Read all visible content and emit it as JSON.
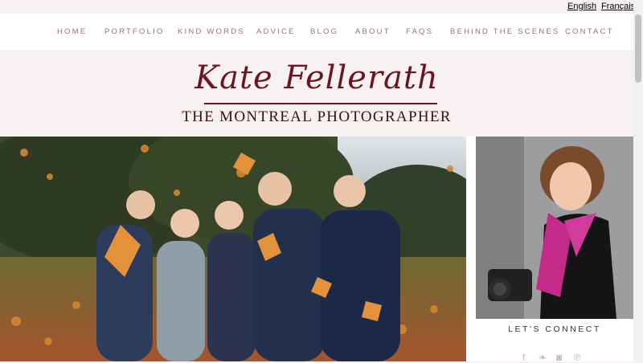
{
  "languages": {
    "english": "English",
    "french": "Français"
  },
  "nav": {
    "items": [
      "HOME",
      "PORTFOLIO",
      "KIND WORDS",
      "ADVICE",
      "BLOG",
      "ABOUT",
      "FAQS",
      "BEHIND THE SCENES",
      "CONTACT"
    ]
  },
  "logo": {
    "name": "Kate Fellerath",
    "tagline": "THE MONTREAL PHOTOGRAPHER"
  },
  "sidebar": {
    "connect_heading": "LET'S CONNECT",
    "social_icons": [
      "facebook-icon",
      "twitter-icon",
      "instagram-icon",
      "pinterest-icon"
    ]
  },
  "colors": {
    "background": "#f8f1f1",
    "nav_text": "#9a7070",
    "logo": "#6b1520"
  }
}
